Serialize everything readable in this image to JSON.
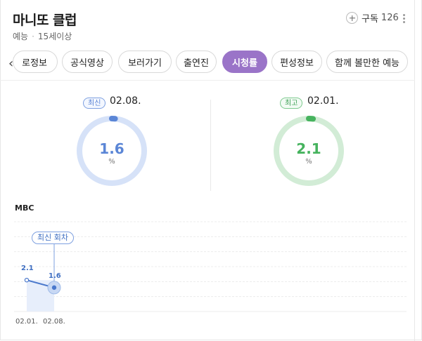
{
  "header": {
    "title": "마니또 클럽",
    "genre": "예능",
    "rating": "15세이상",
    "subscribe_label": "구독",
    "subscribe_count": "126"
  },
  "tabs": [
    {
      "label": "프로그램 정보",
      "visible_label": "로정보",
      "active": false
    },
    {
      "label": "공식영상",
      "active": false
    },
    {
      "label": "보러가기",
      "active": false
    },
    {
      "label": "출연진",
      "active": false
    },
    {
      "label": "시청률",
      "active": true
    },
    {
      "label": "편성정보",
      "active": false
    },
    {
      "label": "함께 볼만한 예능",
      "active": false
    }
  ],
  "stats": {
    "latest": {
      "badge": "최신",
      "date": "02.08.",
      "value": "1.6",
      "unit": "%",
      "fraction": 0.016,
      "color": "#5b86d6",
      "track": "#d6e2f8"
    },
    "highest": {
      "badge": "최고",
      "date": "02.01.",
      "value": "2.1",
      "unit": "%",
      "fraction": 0.021,
      "color": "#46b35e",
      "track": "#d2ecd6"
    }
  },
  "chart_data": {
    "type": "line",
    "title": "MBC",
    "categories": [
      "02.01.",
      "02.08."
    ],
    "series": [
      {
        "values": [
          2.1,
          1.6
        ]
      }
    ],
    "ylim": [
      0,
      6
    ],
    "grid": true,
    "annotation": "최신 회차",
    "highlight_index": 1,
    "color": "#4a78cc"
  },
  "icons": {
    "back": "chevron-left-icon",
    "subscribe": "plus-circle-icon",
    "more": "more-vertical-icon"
  }
}
